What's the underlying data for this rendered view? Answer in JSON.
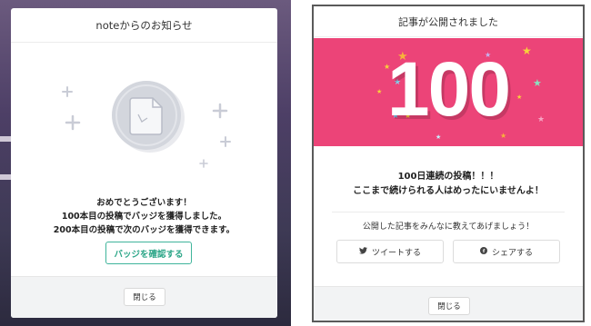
{
  "left_modal": {
    "title": "noteからのお知らせ",
    "message_lines": [
      "おめでとうございます！",
      "100本目の投稿でバッジを獲得しました。",
      "200本目の投稿で次のバッジを獲得できます。"
    ],
    "confirm_button": "バッジを確認する",
    "close_button": "閉じる",
    "badge_icon": "document-icon",
    "accent_color": "#2aa587"
  },
  "right_modal": {
    "title": "記事が公開されました",
    "banner_number": "100",
    "banner_color": "#ec4478",
    "message_lines": [
      "100日連続の投稿！！！",
      "ここまで続けられる人はめったにいませんよ！"
    ],
    "share_prompt": "公開した記事をみんなに教えてあげましょう！",
    "tweet_button": "ツイートする",
    "share_button": "シェアする",
    "tweet_icon": "twitter-icon",
    "share_icon": "facebook-icon",
    "close_button": "閉じる"
  }
}
